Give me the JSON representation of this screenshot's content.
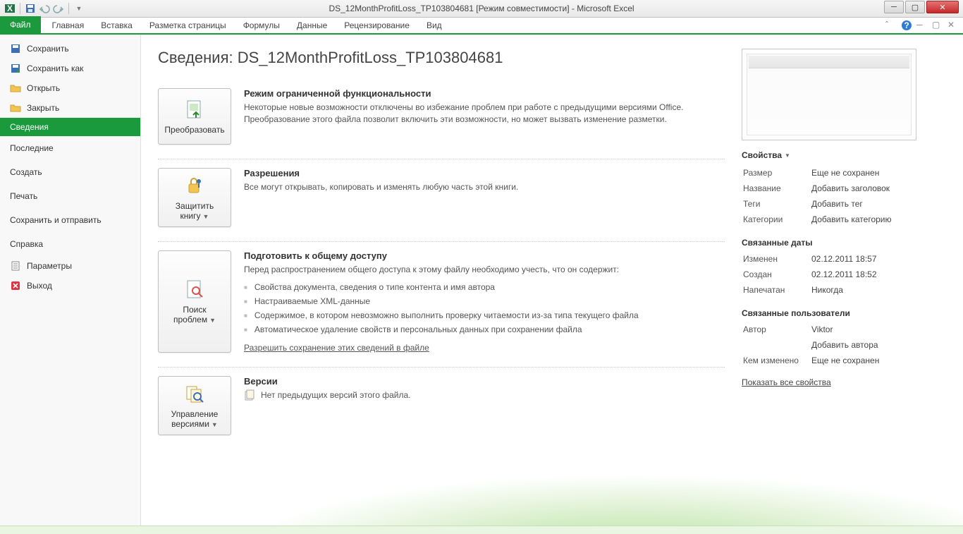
{
  "titlebar": {
    "title": "DS_12MonthProfitLoss_TP103804681  [Режим совместимости]  -  Microsoft Excel"
  },
  "ribbon": {
    "file": "Файл",
    "tabs": [
      "Главная",
      "Вставка",
      "Разметка страницы",
      "Формулы",
      "Данные",
      "Рецензирование",
      "Вид"
    ]
  },
  "backstage_nav": {
    "save": "Сохранить",
    "save_as": "Сохранить как",
    "open": "Открыть",
    "close": "Закрыть",
    "info": "Сведения",
    "recent": "Последние",
    "new": "Создать",
    "print": "Печать",
    "save_send": "Сохранить и отправить",
    "help": "Справка",
    "options": "Параметры",
    "exit": "Выход"
  },
  "info": {
    "title": "Сведения: DS_12MonthProfitLoss_TP103804681",
    "compat": {
      "button": "Преобразовать",
      "heading": "Режим ограниченной функциональности",
      "text": "Некоторые новые возможности отключены во избежание проблем при работе с предыдущими версиями Office. Преобразование этого файла позволит включить эти возможности, но может вызвать изменение разметки."
    },
    "perm": {
      "button": "Защитить книгу",
      "heading": "Разрешения",
      "text": "Все могут открывать, копировать и изменять любую часть этой книги."
    },
    "prepare": {
      "button": "Поиск проблем",
      "heading": "Подготовить к общему доступу",
      "intro": "Перед распространением общего доступа к этому файлу необходимо учесть, что он содержит:",
      "items": [
        "Свойства документа, сведения о типе контента и имя автора",
        "Настраиваемые XML-данные",
        "Содержимое, в котором невозможно выполнить проверку читаемости из-за типа текущего файла",
        "Автоматическое удаление свойств и персональных данных при сохранении файла"
      ],
      "link": "Разрешить сохранение этих сведений в файле"
    },
    "versions": {
      "button": "Управление версиями",
      "heading": "Версии",
      "text": "Нет предыдущих версий этого файла."
    }
  },
  "props": {
    "header": "Свойства",
    "size_k": "Размер",
    "size_v": "Еще не сохранен",
    "title_k": "Название",
    "title_v": "Добавить заголовок",
    "tags_k": "Теги",
    "tags_v": "Добавить тег",
    "cat_k": "Категории",
    "cat_v": "Добавить категорию",
    "dates_hdr": "Связанные даты",
    "mod_k": "Изменен",
    "mod_v": "02.12.2011 18:57",
    "created_k": "Создан",
    "created_v": "02.12.2011 18:52",
    "printed_k": "Напечатан",
    "printed_v": "Никогда",
    "people_hdr": "Связанные пользователи",
    "author_k": "Автор",
    "author_v": "Viktor",
    "add_author": "Добавить автора",
    "lastmod_k": "Кем изменено",
    "lastmod_v": "Еще не сохранен",
    "show_all": "Показать все свойства"
  }
}
